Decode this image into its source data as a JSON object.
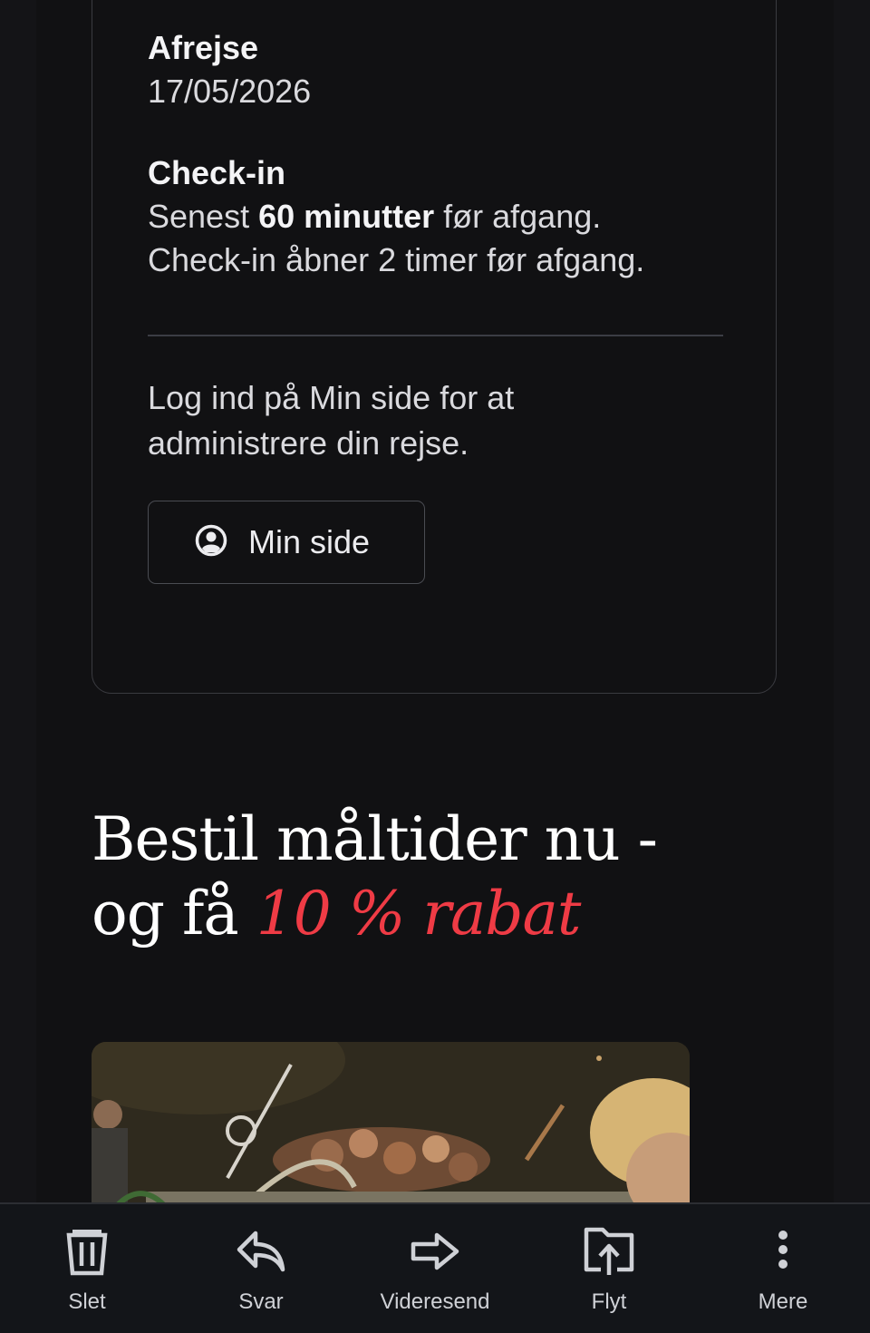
{
  "trip": {
    "departure_label": "Afrejse",
    "departure_date": "17/05/2026",
    "checkin_label": "Check-in",
    "checkin_prefix": "Senest ",
    "checkin_bold": "60 minutter",
    "checkin_suffix": " før afgang.",
    "checkin_opens": "Check-in åbner 2 timer før afgang.",
    "login_text": "Log ind på Min side for at administrere din rejse.",
    "min_side_button": "Min side",
    "account_icon": "account-circle-icon"
  },
  "promo": {
    "line1": "Bestil måltider nu -",
    "line2_prefix": "og få ",
    "line2_accent": "10 % rabat",
    "accent_color": "#ef3b45"
  },
  "toolbar": {
    "items": [
      {
        "label": "Slet",
        "icon": "trash-icon"
      },
      {
        "label": "Svar",
        "icon": "reply-icon"
      },
      {
        "label": "Videresend",
        "icon": "forward-icon"
      },
      {
        "label": "Flyt",
        "icon": "move-icon"
      },
      {
        "label": "Mere",
        "icon": "more-vertical-icon"
      }
    ]
  }
}
